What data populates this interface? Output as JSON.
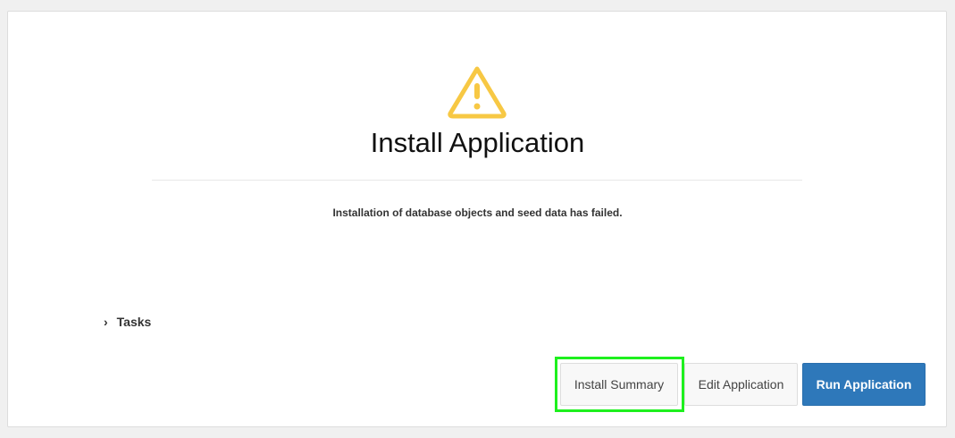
{
  "title": "Install Application",
  "message": "Installation of database objects and seed data has failed.",
  "tasks_label": "Tasks",
  "buttons": {
    "install_summary": "Install Summary",
    "edit_application": "Edit Application",
    "run_application": "Run Application"
  },
  "colors": {
    "warning": "#f7c844",
    "primary": "#2e78ba",
    "highlight": "#1ef01e"
  }
}
